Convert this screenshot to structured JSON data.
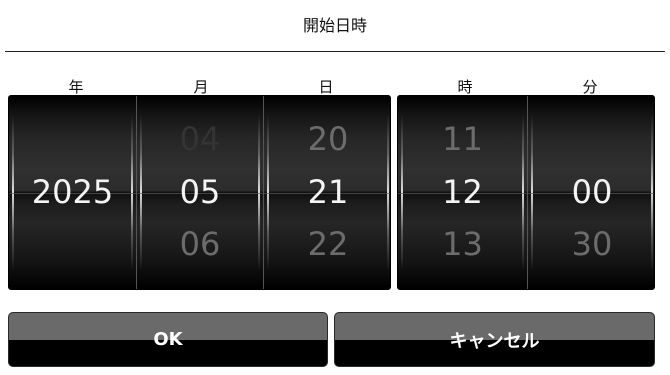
{
  "dialog": {
    "title": "開始日時"
  },
  "columns": [
    {
      "label": "年",
      "prev": "",
      "current": "2025",
      "next": ""
    },
    {
      "label": "月",
      "prev": "04",
      "current": "05",
      "next": "06"
    },
    {
      "label": "日",
      "prev": "20",
      "current": "21",
      "next": "22"
    },
    {
      "label": "時",
      "prev": "11",
      "current": "12",
      "next": "13"
    },
    {
      "label": "分",
      "prev": "",
      "current": "00",
      "next": "30"
    }
  ],
  "buttons": {
    "ok": "OK",
    "cancel": "キャンセル"
  }
}
